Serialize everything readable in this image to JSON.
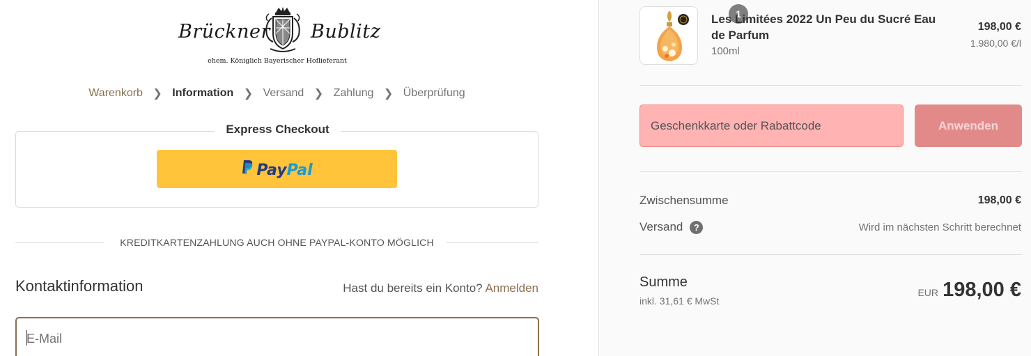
{
  "logo": {
    "name_left": "Brückner",
    "name_right": "Bublitz",
    "subtitle": "ehem. Königlich Bayerischer Hoflieferant"
  },
  "breadcrumb": {
    "cart": "Warenkorb",
    "information": "Information",
    "shipping": "Versand",
    "payment": "Zahlung",
    "review": "Überprüfung"
  },
  "express": {
    "title": "Express Checkout",
    "paypal_pay": "Pay",
    "paypal_pal": "Pal"
  },
  "divider": {
    "text": "KREDITKARTENZAHLUNG AUCH OHNE PAYPAL-KONTO MÖGLICH"
  },
  "contact": {
    "title": "Kontaktinformation",
    "login_prompt": "Hast du bereits ein Konto?",
    "login_link": "Anmelden",
    "email_placeholder": "E-Mail"
  },
  "cart": {
    "item": {
      "quantity": "1",
      "title": "Les Limitées 2022 Un Peu du Sucré Eau de Parfum",
      "variant": "100ml",
      "price": "198,00 €",
      "unit_price": "1.980,00 €/l"
    },
    "discount": {
      "placeholder": "Geschenkkarte oder Rabattcode",
      "apply_label": "Anwenden"
    },
    "subtotal_label": "Zwischensumme",
    "subtotal_value": "198,00 €",
    "shipping_label": "Versand",
    "shipping_value": "Wird im nächsten Schritt berechnet",
    "total_label": "Summe",
    "tax_note": "inkl. 31,61 € MwSt",
    "currency": "EUR",
    "total_value": "198,00 €"
  },
  "colors": {
    "accent": "#8b6f4e",
    "paypal_yellow": "#ffc439",
    "error_bg": "#ffb3b3"
  }
}
